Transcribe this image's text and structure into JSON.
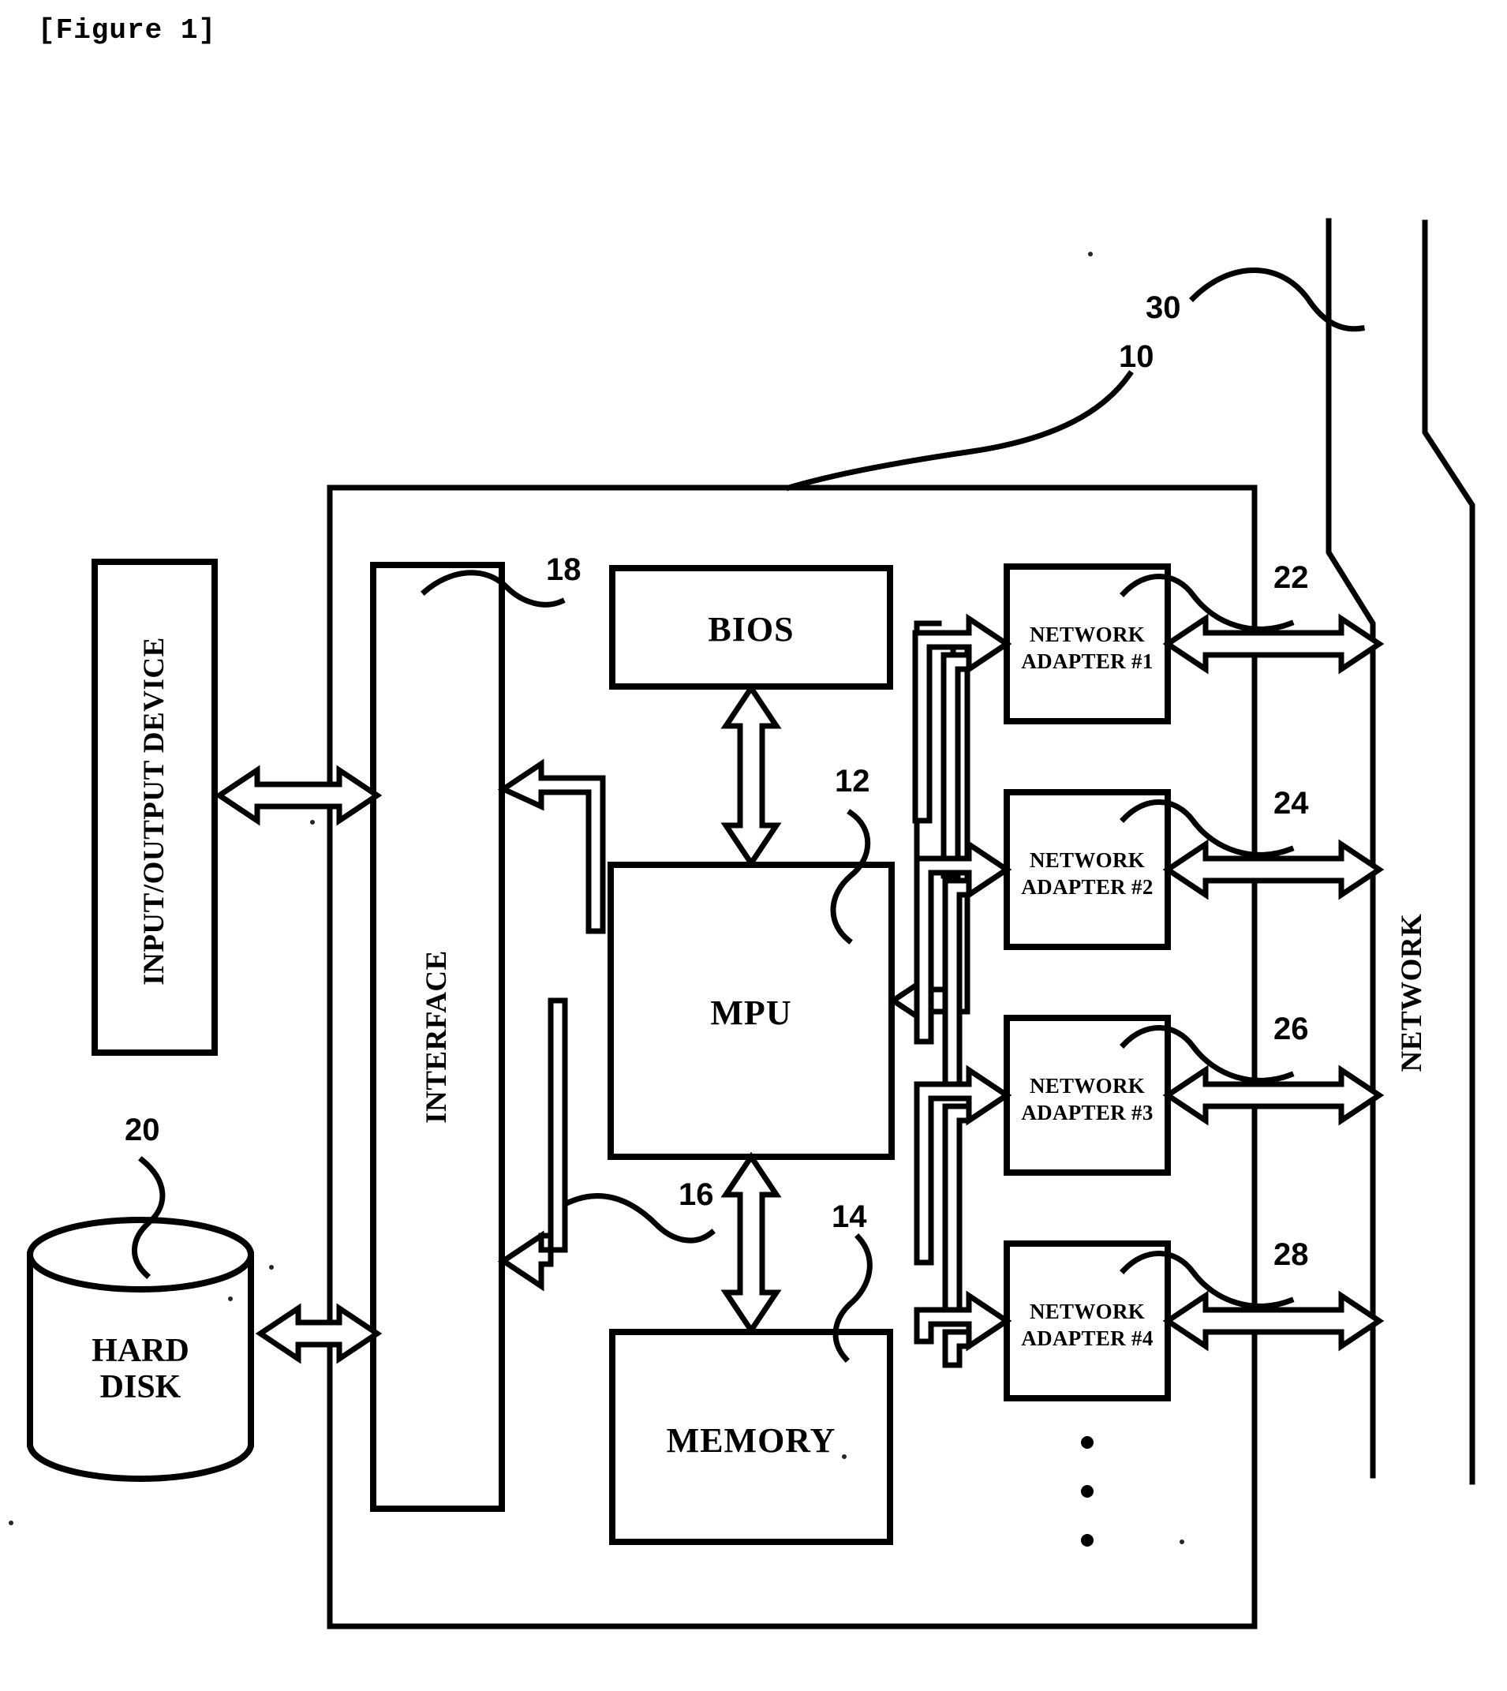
{
  "figure": {
    "title": "[Figure 1]",
    "type": "patent-block-diagram"
  },
  "blocks": {
    "io_device": {
      "label": "INPUT/OUTPUT DEVICE",
      "orientation": "vertical"
    },
    "hard_disk": {
      "label_line1": "HARD",
      "label_line2": "DISK",
      "shape": "cylinder",
      "ref": "20"
    },
    "interface": {
      "label": "INTERFACE",
      "orientation": "vertical",
      "ref": "18"
    },
    "bios": {
      "label": "BIOS"
    },
    "mpu": {
      "label": "MPU",
      "ref": "12"
    },
    "memory": {
      "label": "MEMORY",
      "ref": "14"
    },
    "bus": {
      "ref": "16"
    },
    "system": {
      "ref": "10"
    },
    "network_line": {
      "ref": "30"
    },
    "network_side": {
      "label": "NETWORK"
    }
  },
  "adapters": [
    {
      "line1": "NETWORK",
      "line2": "ADAPTER #1",
      "ref": "22"
    },
    {
      "line1": "NETWORK",
      "line2": "ADAPTER #2",
      "ref": "24"
    },
    {
      "line1": "NETWORK",
      "line2": "ADAPTER #3",
      "ref": "26"
    },
    {
      "line1": "NETWORK",
      "line2": "ADAPTER #4",
      "ref": "28"
    }
  ],
  "ellipsis": "vertical-three-dots",
  "colors": {
    "ink": "#000000",
    "paper": "#ffffff"
  }
}
